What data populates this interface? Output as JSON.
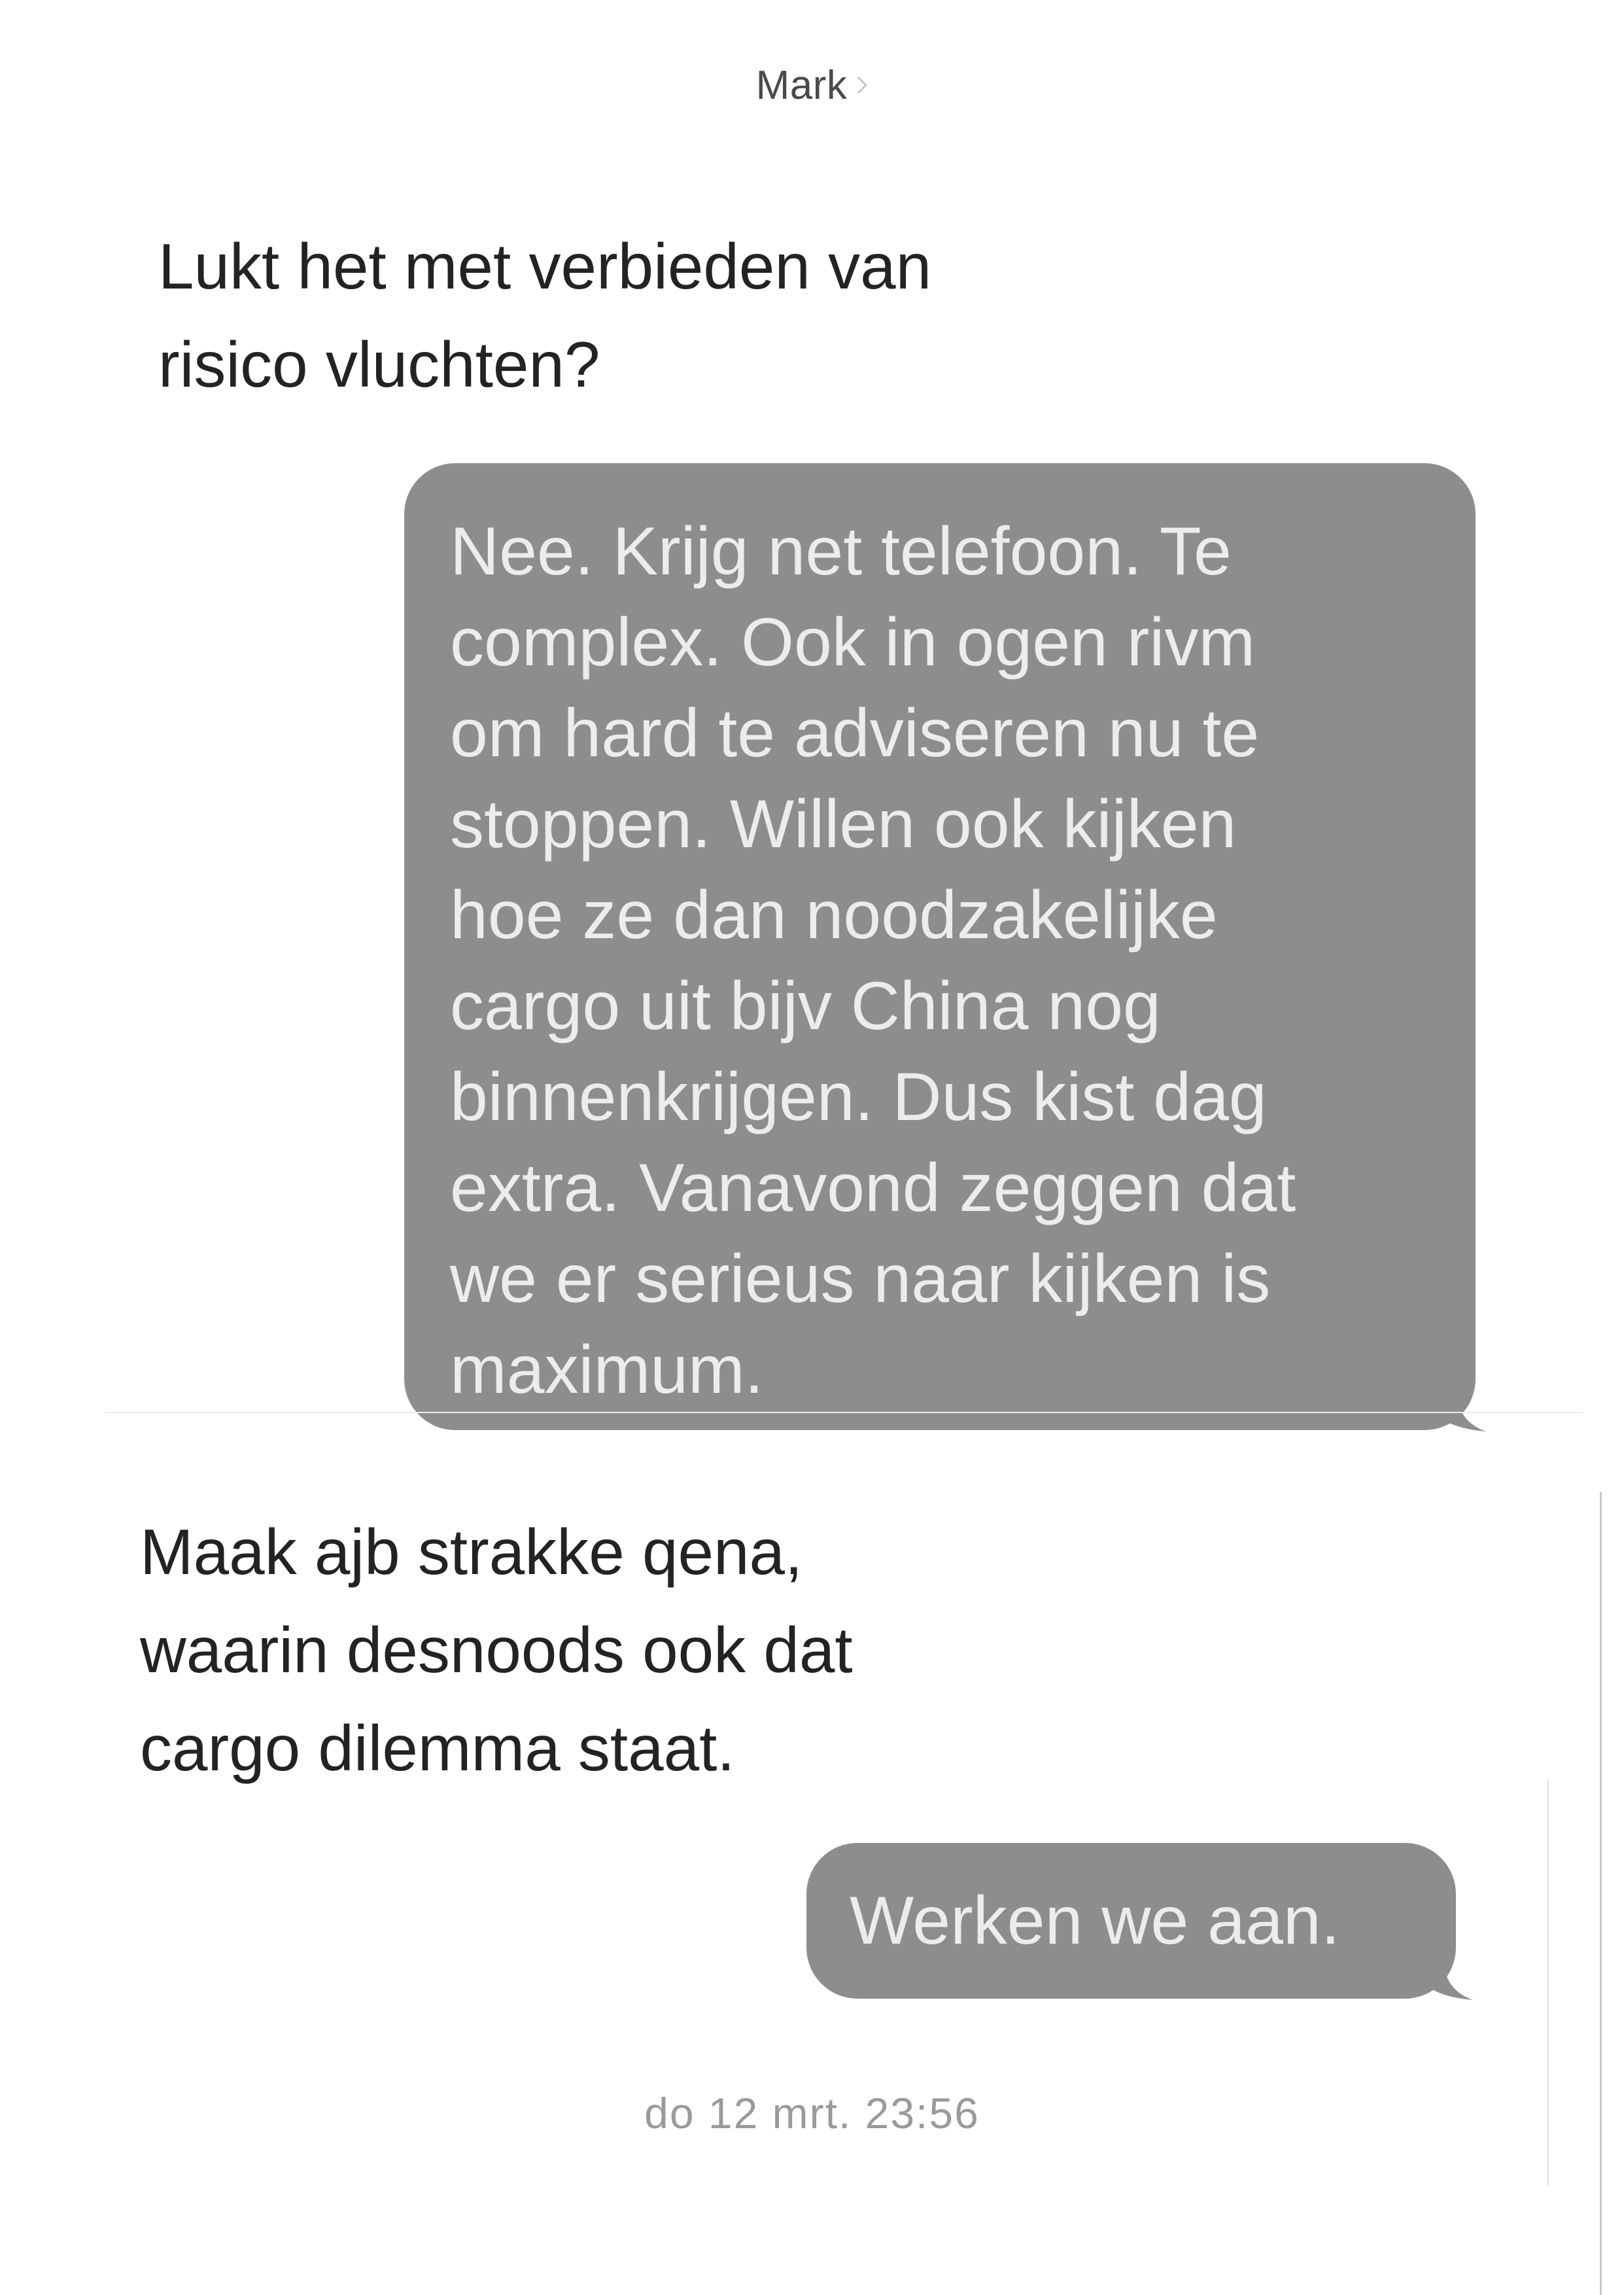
{
  "header": {
    "contact_name": "Mark",
    "chevron_icon": "chevron-right-icon"
  },
  "messages": [
    {
      "direction": "incoming",
      "text": "Lukt het met verbieden van\nrisico vluchten?"
    },
    {
      "direction": "outgoing",
      "text": "Nee. Krijg net telefoon. Te\ncomplex. Ook in ogen rivm\nom hard te adviseren nu te\nstoppen. Willen ook kijken\nhoe ze dan noodzakelijke\ncargo uit bijv China nog\nbinnenkrijgen. Dus kist dag\nextra. Vanavond zeggen dat\nwe er serieus naar kijken is\nmaximum."
    },
    {
      "direction": "incoming",
      "text": "Maak ajb strakke qena,\nwaarin desnoods ook dat\ncargo dilemma staat."
    },
    {
      "direction": "outgoing",
      "text": "Werken we aan."
    }
  ],
  "timestamp": "do 12 mrt. 23:56",
  "colors": {
    "outgoing_bubble": "#8d8d8d",
    "outgoing_text": "#ececec",
    "incoming_text": "#232323",
    "timestamp": "#9a9a9a",
    "header_text": "#4a4a4a"
  }
}
